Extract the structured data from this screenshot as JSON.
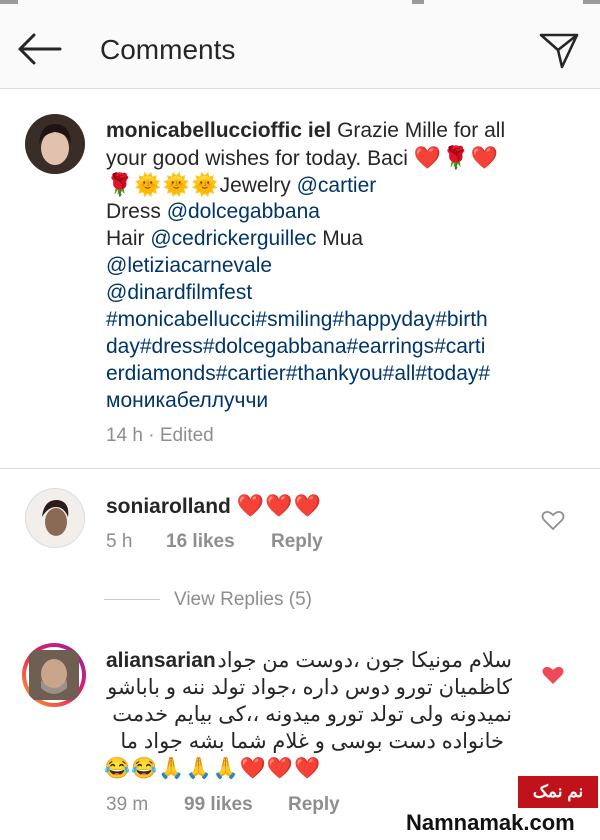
{
  "header": {
    "title": "Comments"
  },
  "caption": {
    "username": "monicabelluccioffic iel",
    "line1_text": " Grazie Mille for all",
    "line2_text": "your good wishes for today. Baci ",
    "line2_emoji": "❤️🌹❤️",
    "line3_emoji": "🌹🌞🌞🌞",
    "line3_text": "Jewelry ",
    "line3_link": "@cartier",
    "line4_text": "Dress ",
    "line4_link": "@dolcegabbana",
    "line5_text": "Hair ",
    "line5_link": "@cedrickerguillec",
    "line5_suffix": " Mua",
    "line6_link": "@letiziacarnevale",
    "line7_link": "@dinardfilmfest",
    "line8_link": "#monicabellucci#smiling#happyday#birth",
    "line9_link": "day#dress#dolcegabbana#earrings#carti",
    "line10_link": "erdiamonds#cartier#thankyou#all#today#",
    "line11_link": "моникабеллуччи",
    "time": "14 h",
    "edited": "· Edited"
  },
  "comments": [
    {
      "username": "soniarolland",
      "emoji": "❤️❤️❤️",
      "time": "5 h",
      "likes": "16 likes",
      "reply": "Reply",
      "liked": false
    },
    {
      "username": "aliansarian",
      "line1": "سلام مونیکا جون ،دوست من جواد",
      "line2": "کاظمیان تورو دوس داره ،جواد تولد ننه و باباشو",
      "line3": "نمیدونه ولی تولد تورو میدونه ،،کی بیایم خدمت",
      "line4": "خانواده دست بوسی و غلام شما بشه جواد ما",
      "line5": "😂😂🙏🙏🙏❤️❤️❤️",
      "time": "39 m",
      "likes": "99 likes",
      "reply": "Reply",
      "liked": true
    }
  ],
  "view_replies": "View Replies (5)",
  "watermark": {
    "badge": "نم نمک",
    "site": "Namnamak.com"
  },
  "colors": {
    "link": "#003569",
    "heart": "#e8384f",
    "meta": "#8e8e8e",
    "watermark_red": "#c0121a"
  }
}
